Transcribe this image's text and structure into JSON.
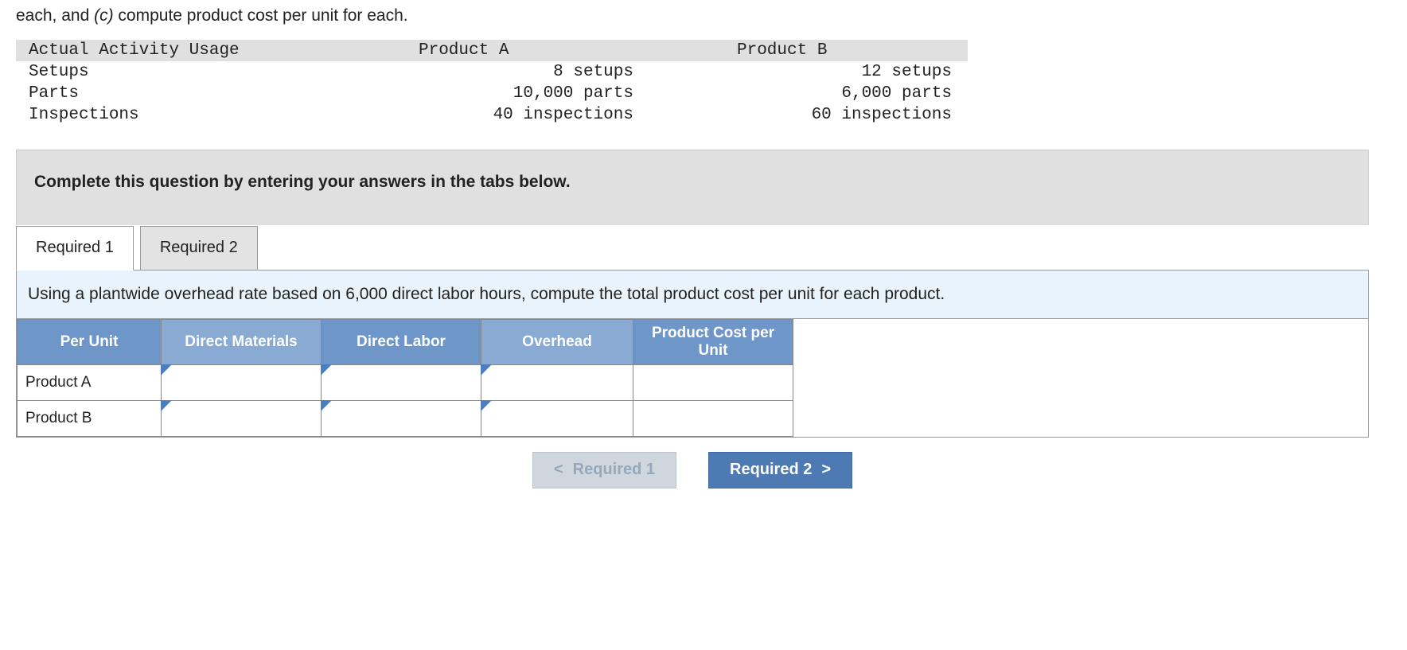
{
  "intro": {
    "prefix": "each, and ",
    "part_label": "(c)",
    "suffix": " compute product cost per unit for each."
  },
  "activity_table": {
    "header": {
      "c1": "Actual Activity Usage",
      "c2": "Product A",
      "c3": "Product B"
    },
    "rows": [
      {
        "label": "Setups",
        "a": "8 setups",
        "b": "12 setups"
      },
      {
        "label": "Parts",
        "a": "10,000 parts",
        "b": "6,000 parts"
      },
      {
        "label": "Inspections",
        "a": "40 inspections",
        "b": "60 inspections"
      }
    ]
  },
  "banner": "Complete this question by entering your answers in the tabs below.",
  "tabs": {
    "t1": "Required 1",
    "t2": "Required 2"
  },
  "instruction": "Using a plantwide overhead rate based on 6,000 direct labor hours, compute the total product cost per unit for each product.",
  "grid": {
    "headers": {
      "per_unit": "Per Unit",
      "dm": "Direct Materials",
      "dl": "Direct Labor",
      "oh": "Overhead",
      "pc": "Product Cost per Unit"
    },
    "rows": {
      "a": "Product A",
      "b": "Product B"
    }
  },
  "nav": {
    "prev_chev": "<",
    "prev": "Required 1",
    "next": "Required 2",
    "next_chev": ">"
  }
}
